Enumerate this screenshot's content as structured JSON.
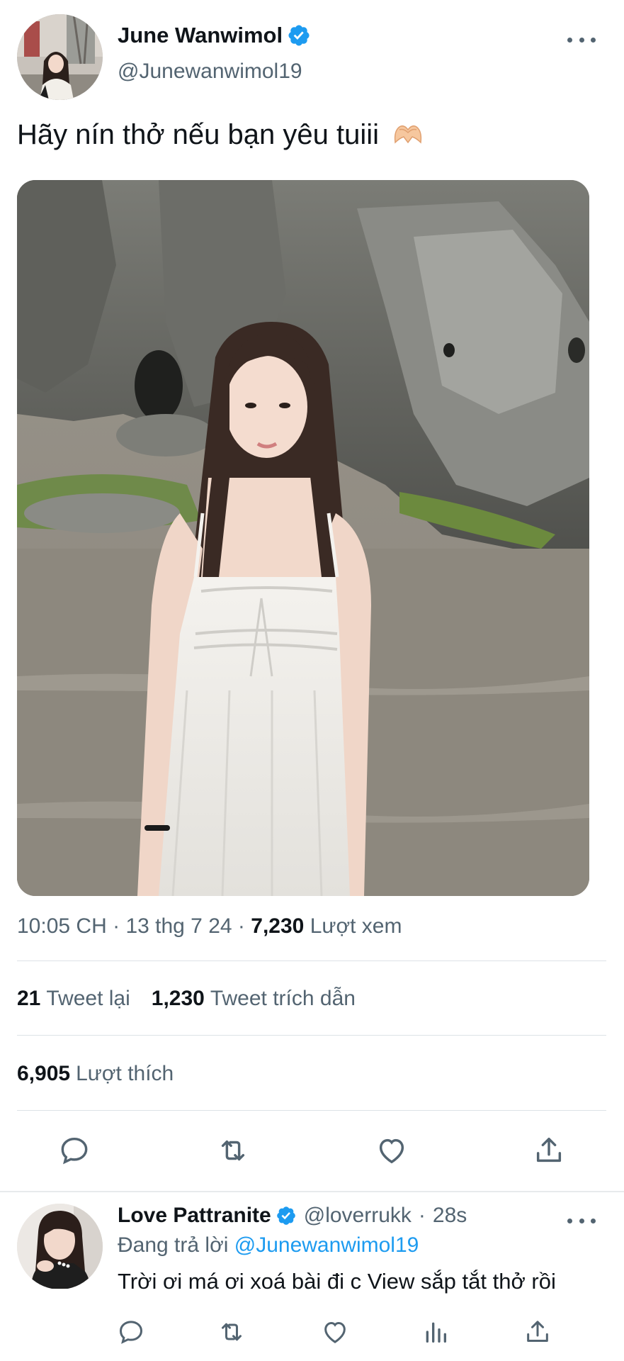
{
  "tweet": {
    "author_name": "June Wanwimol",
    "author_handle": "@Junewanwimol19",
    "text": "Hãy nín thở nếu bạn yêu tuiii",
    "time": "10:05 CH",
    "date": "13 thg 7 24",
    "views_count": "7,230",
    "views_label": "Lượt xem",
    "retweets_count": "21",
    "retweets_label": "Tweet lại",
    "quotes_count": "1,230",
    "quotes_label": "Tweet trích dẫn",
    "likes_count": "6,905",
    "likes_label": "Lượt thích",
    "separator": "·"
  },
  "reply": {
    "author_name": "Love Pattranite",
    "author_handle": "@loverrukk",
    "time": "28s",
    "replying_to_label": "Đang trả lời",
    "replying_to_handle": "@Junewanwimol19",
    "text": "Trời ơi má ơi xoá bài đi c View sắp tắt thở rồi"
  },
  "icons": {
    "verified": "verified-badge-icon",
    "reply": "reply-icon",
    "retweet": "retweet-icon",
    "like": "heart-icon",
    "share": "share-icon",
    "views": "analytics-icon",
    "more": "more-dots-icon",
    "emoji": "heart-hands-emoji"
  },
  "colors": {
    "accent": "#1d9bf0",
    "text_primary": "#0f1419",
    "text_secondary": "#536471",
    "divider": "#dde2e6"
  }
}
